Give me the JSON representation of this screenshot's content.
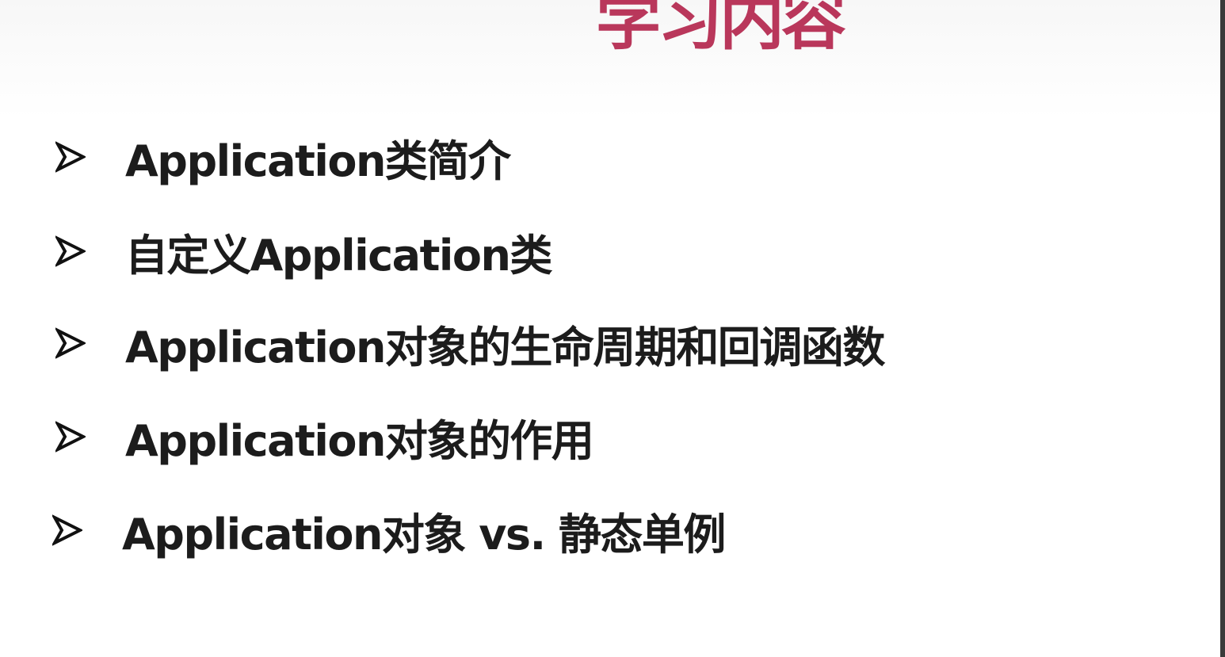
{
  "slide": {
    "title": "学习内容",
    "title_color": "#b9375b",
    "bullet_icon": "arrowhead-bullet-icon",
    "items": [
      {
        "text": "Application类简介"
      },
      {
        "text": "自定义Application类"
      },
      {
        "text": "Application对象的生命周期和回调函数"
      },
      {
        "text": "Application对象的作用"
      },
      {
        "text": "Application对象 vs. 静态单例"
      }
    ]
  }
}
